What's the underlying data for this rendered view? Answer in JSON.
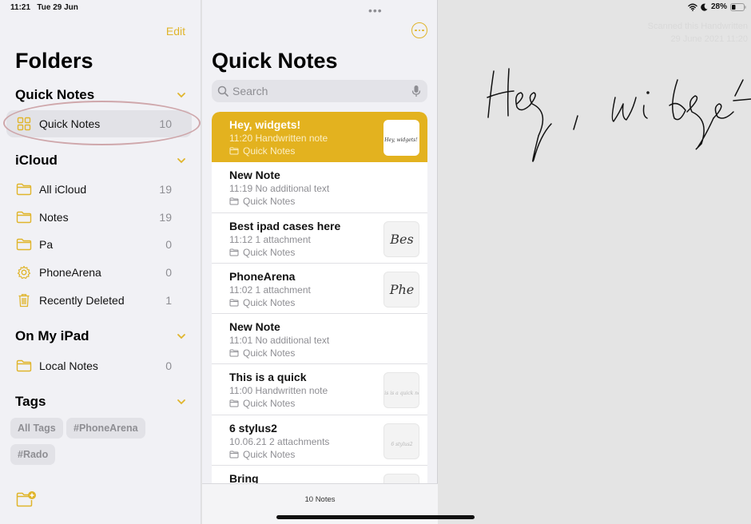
{
  "status": {
    "time": "11:21",
    "date": "Tue 29 Jun",
    "battery": "28%"
  },
  "sidebar": {
    "edit_label": "Edit",
    "title": "Folders",
    "sections": {
      "quick_notes": {
        "label": "Quick Notes",
        "items": [
          {
            "label": "Quick Notes",
            "count": "10",
            "icon": "grid-icon"
          }
        ]
      },
      "icloud": {
        "label": "iCloud",
        "items": [
          {
            "label": "All iCloud",
            "count": "19",
            "icon": "folder-icon"
          },
          {
            "label": "Notes",
            "count": "19",
            "icon": "folder-icon"
          },
          {
            "label": "Pa",
            "count": "0",
            "icon": "folder-icon"
          },
          {
            "label": "PhoneArena",
            "count": "0",
            "icon": "gear-icon"
          },
          {
            "label": "Recently Deleted",
            "count": "1",
            "icon": "trash-icon"
          }
        ]
      },
      "on_my_ipad": {
        "label": "On My iPad",
        "items": [
          {
            "label": "Local Notes",
            "count": "0",
            "icon": "folder-icon"
          }
        ]
      },
      "tags": {
        "label": "Tags",
        "items": [
          "All Tags",
          "#PhoneArena",
          "#Rado"
        ]
      }
    }
  },
  "list": {
    "title": "Quick Notes",
    "search_placeholder": "Search",
    "notes": [
      {
        "title": "Hey, widgets!",
        "meta": "11:20  Handwritten note",
        "folder": "Quick Notes",
        "thumb": "Hey, widgets!"
      },
      {
        "title": "New Note",
        "meta": "11:19  No additional text",
        "folder": "Quick Notes",
        "thumb": ""
      },
      {
        "title": "Best ipad cases here",
        "meta": "11:12  1 attachment",
        "folder": "Quick Notes",
        "thumb": "Bes"
      },
      {
        "title": "PhoneArena",
        "meta": "11:02  1 attachment",
        "folder": "Quick Notes",
        "thumb": "Phe"
      },
      {
        "title": "New Note",
        "meta": "11:01  No additional text",
        "folder": "Quick Notes",
        "thumb": ""
      },
      {
        "title": "This is a quick",
        "meta": "11:00  Handwritten note",
        "folder": "Quick Notes",
        "thumb": "This is a quick note"
      },
      {
        "title": "6 stylus2",
        "meta": "10.06.21  2 attachments",
        "folder": "Quick Notes",
        "thumb": "6 stylus2"
      },
      {
        "title": "Bring",
        "meta": "",
        "folder": "",
        "thumb": ""
      }
    ],
    "count_label": "10 Notes"
  },
  "editor": {
    "handwriting": "Hey, widgets!",
    "faint_line1": "Scanned this Handwritten",
    "faint_line2": "29 June 2021 11:20"
  },
  "colors": {
    "accent": "#e0b52c",
    "selected_note": "#e3b21f"
  }
}
